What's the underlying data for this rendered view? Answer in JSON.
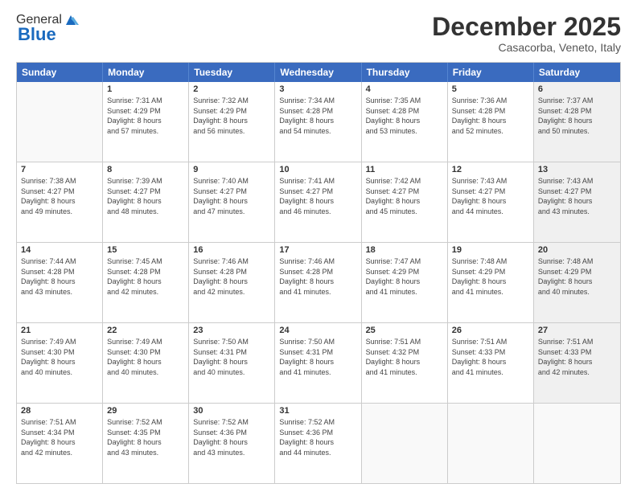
{
  "header": {
    "logo_general": "General",
    "logo_blue": "Blue",
    "month_title": "December 2025",
    "location": "Casacorba, Veneto, Italy"
  },
  "weekdays": [
    "Sunday",
    "Monday",
    "Tuesday",
    "Wednesday",
    "Thursday",
    "Friday",
    "Saturday"
  ],
  "rows": [
    [
      {
        "day": "",
        "info": "",
        "empty": true
      },
      {
        "day": "1",
        "info": "Sunrise: 7:31 AM\nSunset: 4:29 PM\nDaylight: 8 hours\nand 57 minutes."
      },
      {
        "day": "2",
        "info": "Sunrise: 7:32 AM\nSunset: 4:29 PM\nDaylight: 8 hours\nand 56 minutes."
      },
      {
        "day": "3",
        "info": "Sunrise: 7:34 AM\nSunset: 4:28 PM\nDaylight: 8 hours\nand 54 minutes."
      },
      {
        "day": "4",
        "info": "Sunrise: 7:35 AM\nSunset: 4:28 PM\nDaylight: 8 hours\nand 53 minutes."
      },
      {
        "day": "5",
        "info": "Sunrise: 7:36 AM\nSunset: 4:28 PM\nDaylight: 8 hours\nand 52 minutes."
      },
      {
        "day": "6",
        "info": "Sunrise: 7:37 AM\nSunset: 4:28 PM\nDaylight: 8 hours\nand 50 minutes.",
        "shaded": true
      }
    ],
    [
      {
        "day": "7",
        "info": "Sunrise: 7:38 AM\nSunset: 4:27 PM\nDaylight: 8 hours\nand 49 minutes."
      },
      {
        "day": "8",
        "info": "Sunrise: 7:39 AM\nSunset: 4:27 PM\nDaylight: 8 hours\nand 48 minutes."
      },
      {
        "day": "9",
        "info": "Sunrise: 7:40 AM\nSunset: 4:27 PM\nDaylight: 8 hours\nand 47 minutes."
      },
      {
        "day": "10",
        "info": "Sunrise: 7:41 AM\nSunset: 4:27 PM\nDaylight: 8 hours\nand 46 minutes."
      },
      {
        "day": "11",
        "info": "Sunrise: 7:42 AM\nSunset: 4:27 PM\nDaylight: 8 hours\nand 45 minutes."
      },
      {
        "day": "12",
        "info": "Sunrise: 7:43 AM\nSunset: 4:27 PM\nDaylight: 8 hours\nand 44 minutes."
      },
      {
        "day": "13",
        "info": "Sunrise: 7:43 AM\nSunset: 4:27 PM\nDaylight: 8 hours\nand 43 minutes.",
        "shaded": true
      }
    ],
    [
      {
        "day": "14",
        "info": "Sunrise: 7:44 AM\nSunset: 4:28 PM\nDaylight: 8 hours\nand 43 minutes."
      },
      {
        "day": "15",
        "info": "Sunrise: 7:45 AM\nSunset: 4:28 PM\nDaylight: 8 hours\nand 42 minutes."
      },
      {
        "day": "16",
        "info": "Sunrise: 7:46 AM\nSunset: 4:28 PM\nDaylight: 8 hours\nand 42 minutes."
      },
      {
        "day": "17",
        "info": "Sunrise: 7:46 AM\nSunset: 4:28 PM\nDaylight: 8 hours\nand 41 minutes."
      },
      {
        "day": "18",
        "info": "Sunrise: 7:47 AM\nSunset: 4:29 PM\nDaylight: 8 hours\nand 41 minutes."
      },
      {
        "day": "19",
        "info": "Sunrise: 7:48 AM\nSunset: 4:29 PM\nDaylight: 8 hours\nand 41 minutes."
      },
      {
        "day": "20",
        "info": "Sunrise: 7:48 AM\nSunset: 4:29 PM\nDaylight: 8 hours\nand 40 minutes.",
        "shaded": true
      }
    ],
    [
      {
        "day": "21",
        "info": "Sunrise: 7:49 AM\nSunset: 4:30 PM\nDaylight: 8 hours\nand 40 minutes."
      },
      {
        "day": "22",
        "info": "Sunrise: 7:49 AM\nSunset: 4:30 PM\nDaylight: 8 hours\nand 40 minutes."
      },
      {
        "day": "23",
        "info": "Sunrise: 7:50 AM\nSunset: 4:31 PM\nDaylight: 8 hours\nand 40 minutes."
      },
      {
        "day": "24",
        "info": "Sunrise: 7:50 AM\nSunset: 4:31 PM\nDaylight: 8 hours\nand 41 minutes."
      },
      {
        "day": "25",
        "info": "Sunrise: 7:51 AM\nSunset: 4:32 PM\nDaylight: 8 hours\nand 41 minutes."
      },
      {
        "day": "26",
        "info": "Sunrise: 7:51 AM\nSunset: 4:33 PM\nDaylight: 8 hours\nand 41 minutes."
      },
      {
        "day": "27",
        "info": "Sunrise: 7:51 AM\nSunset: 4:33 PM\nDaylight: 8 hours\nand 42 minutes.",
        "shaded": true
      }
    ],
    [
      {
        "day": "28",
        "info": "Sunrise: 7:51 AM\nSunset: 4:34 PM\nDaylight: 8 hours\nand 42 minutes."
      },
      {
        "day": "29",
        "info": "Sunrise: 7:52 AM\nSunset: 4:35 PM\nDaylight: 8 hours\nand 43 minutes."
      },
      {
        "day": "30",
        "info": "Sunrise: 7:52 AM\nSunset: 4:36 PM\nDaylight: 8 hours\nand 43 minutes."
      },
      {
        "day": "31",
        "info": "Sunrise: 7:52 AM\nSunset: 4:36 PM\nDaylight: 8 hours\nand 44 minutes."
      },
      {
        "day": "",
        "info": "",
        "empty": true
      },
      {
        "day": "",
        "info": "",
        "empty": true
      },
      {
        "day": "",
        "info": "",
        "empty": true
      }
    ]
  ]
}
